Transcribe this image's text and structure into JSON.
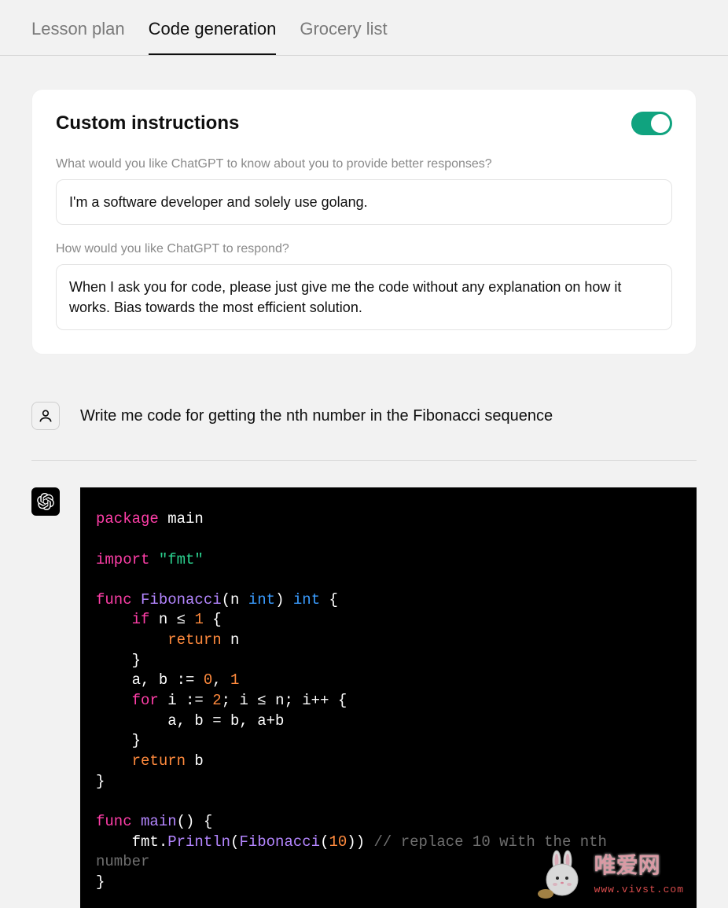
{
  "tabs": [
    {
      "label": "Lesson plan",
      "active": false
    },
    {
      "label": "Code generation",
      "active": true
    },
    {
      "label": "Grocery list",
      "active": false
    }
  ],
  "custom_instructions": {
    "title": "Custom instructions",
    "toggle_on": true,
    "field1_label": "What would you like ChatGPT to know about you to provide better responses?",
    "field1_value": "I'm a software developer and solely use golang.",
    "field2_label": "How would you like ChatGPT to respond?",
    "field2_value": "When I ask you for code, please just give me the code without any explanation on how it works. Bias towards the most efficient solution."
  },
  "user_message": "Write me code for getting the nth number in the Fibonacci sequence",
  "code": {
    "tokens": [
      [
        "keyword",
        "package"
      ],
      [
        "identifier",
        " main"
      ],
      [
        "nl",
        ""
      ],
      [
        "nl",
        ""
      ],
      [
        "keyword",
        "import"
      ],
      [
        "identifier",
        " "
      ],
      [
        "string",
        "\"fmt\""
      ],
      [
        "nl",
        ""
      ],
      [
        "nl",
        ""
      ],
      [
        "keyword",
        "func"
      ],
      [
        "identifier",
        " "
      ],
      [
        "func",
        "Fibonacci"
      ],
      [
        "punc",
        "("
      ],
      [
        "identifier",
        "n "
      ],
      [
        "type",
        "int"
      ],
      [
        "punc",
        ")"
      ],
      [
        "identifier",
        " "
      ],
      [
        "type",
        "int"
      ],
      [
        "punc",
        " {"
      ],
      [
        "nl",
        ""
      ],
      [
        "identifier",
        "    "
      ],
      [
        "keyword",
        "if"
      ],
      [
        "identifier",
        " n ≤ "
      ],
      [
        "num",
        "1"
      ],
      [
        "punc",
        " {"
      ],
      [
        "nl",
        ""
      ],
      [
        "identifier",
        "        "
      ],
      [
        "return",
        "return"
      ],
      [
        "identifier",
        " n"
      ],
      [
        "nl",
        ""
      ],
      [
        "punc",
        "    }"
      ],
      [
        "nl",
        ""
      ],
      [
        "identifier",
        "    a, b := "
      ],
      [
        "num",
        "0"
      ],
      [
        "punc",
        ", "
      ],
      [
        "num",
        "1"
      ],
      [
        "nl",
        ""
      ],
      [
        "identifier",
        "    "
      ],
      [
        "keyword",
        "for"
      ],
      [
        "identifier",
        " i := "
      ],
      [
        "num",
        "2"
      ],
      [
        "punc",
        "; "
      ],
      [
        "identifier",
        "i ≤ n; i++"
      ],
      [
        "punc",
        " {"
      ],
      [
        "nl",
        ""
      ],
      [
        "identifier",
        "        a, b = b, a+b"
      ],
      [
        "nl",
        ""
      ],
      [
        "punc",
        "    }"
      ],
      [
        "nl",
        ""
      ],
      [
        "identifier",
        "    "
      ],
      [
        "return",
        "return"
      ],
      [
        "identifier",
        " b"
      ],
      [
        "nl",
        ""
      ],
      [
        "punc",
        "}"
      ],
      [
        "nl",
        ""
      ],
      [
        "nl",
        ""
      ],
      [
        "keyword",
        "func"
      ],
      [
        "identifier",
        " "
      ],
      [
        "func",
        "main"
      ],
      [
        "punc",
        "() {"
      ],
      [
        "nl",
        ""
      ],
      [
        "identifier",
        "    fmt."
      ],
      [
        "func",
        "Println"
      ],
      [
        "punc",
        "("
      ],
      [
        "func",
        "Fibonacci"
      ],
      [
        "punc",
        "("
      ],
      [
        "num",
        "10"
      ],
      [
        "punc",
        "))"
      ],
      [
        "identifier",
        " "
      ],
      [
        "comment",
        "// replace 10 with the nth"
      ],
      [
        "nl",
        ""
      ],
      [
        "comment",
        "number"
      ],
      [
        "nl",
        ""
      ],
      [
        "punc",
        "}"
      ]
    ]
  },
  "watermark": {
    "text_main": "唯爱网",
    "text_url": "www.vivst.com"
  }
}
